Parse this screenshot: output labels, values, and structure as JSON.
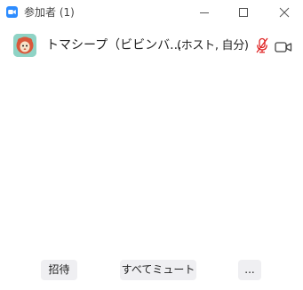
{
  "window": {
    "title": "参加者 (1)",
    "app_icon": "zoom-camera-icon",
    "controls": {
      "minimize_icon": "minimize-icon",
      "maximize_icon": "maximize-icon",
      "close_icon": "close-icon"
    }
  },
  "participants": [
    {
      "name": "トマシープ（ビビンバ...",
      "role": "(ホスト, 自分)",
      "avatar": "sheep-avatar",
      "mic_status": "muted",
      "mic_icon": "mic-muted-icon",
      "video_icon": "video-camera-icon"
    }
  ],
  "footer": {
    "invite_label": "招待",
    "mute_all_label": "すべてミュート",
    "more_label": "..."
  },
  "colors": {
    "accent": "#2d8cff",
    "muted_red": "#e02828",
    "button_bg": "#efeff2"
  }
}
